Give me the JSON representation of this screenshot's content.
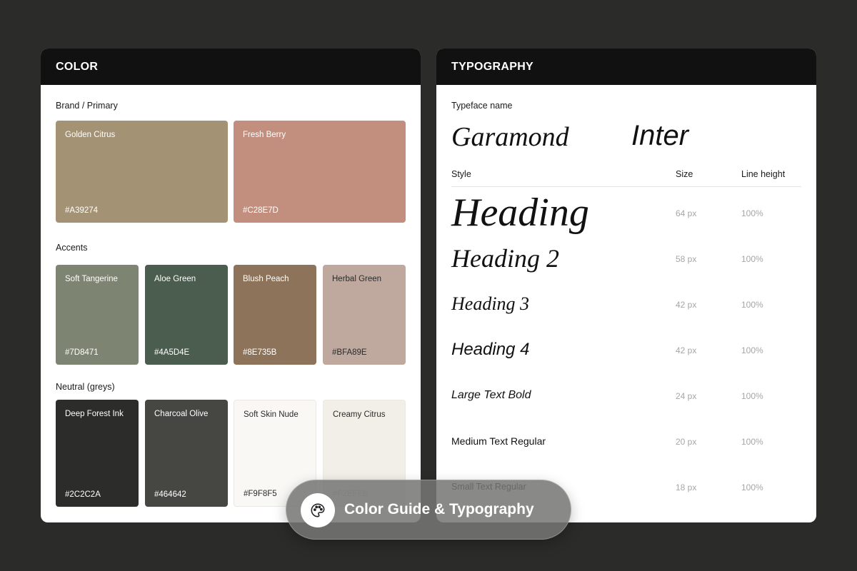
{
  "color_panel": {
    "title": "COLOR",
    "brand": {
      "label": "Brand / Primary",
      "swatches": [
        {
          "name": "Golden Citrus",
          "hex": "#A39274"
        },
        {
          "name": "Fresh Berry",
          "hex": "#C28E7D"
        }
      ]
    },
    "accents": {
      "label": "Accents",
      "swatches": [
        {
          "name": "Soft Tangerine",
          "hex": "#7D8471"
        },
        {
          "name": "Aloe Green",
          "hex": "#4A5D4E"
        },
        {
          "name": "Blush Peach",
          "hex": "#8E735B"
        },
        {
          "name": "Herbal Green",
          "hex": "#BFA89E"
        }
      ]
    },
    "neutral": {
      "label": "Neutral (greys)",
      "swatches": [
        {
          "name": "Deep Forest Ink",
          "hex": "#2C2C2A"
        },
        {
          "name": "Charcoal Olive",
          "hex": "#464642"
        },
        {
          "name": "Soft Skin Nude",
          "hex": "#F9F8F5"
        },
        {
          "name": "Creamy Citrus",
          "hex": "#F2EFE8"
        }
      ]
    }
  },
  "typography_panel": {
    "title": "TYPOGRAPHY",
    "typeface_label": "Typeface name",
    "typefaces": [
      "Garamond",
      "Inter"
    ],
    "columns": {
      "style": "Style",
      "size": "Size",
      "line_height": "Line height"
    },
    "rows": [
      {
        "style": "Heading",
        "size": "64 px",
        "line_height": "100%"
      },
      {
        "style": "Heading 2",
        "size": "58 px",
        "line_height": "100%"
      },
      {
        "style": "Heading 3",
        "size": "42 px",
        "line_height": "100%"
      },
      {
        "style": "Heading 4",
        "size": "42 px",
        "line_height": "100%"
      },
      {
        "style": "Large Text Bold",
        "size": "24 px",
        "line_height": "100%"
      },
      {
        "style": "Medium Text Regular",
        "size": "20 px",
        "line_height": "100%"
      },
      {
        "style": "Small Text Regular",
        "size": "18 px",
        "line_height": "100%"
      }
    ]
  },
  "overlay": {
    "icon": "palette-icon",
    "label": "Color Guide & Typography"
  }
}
